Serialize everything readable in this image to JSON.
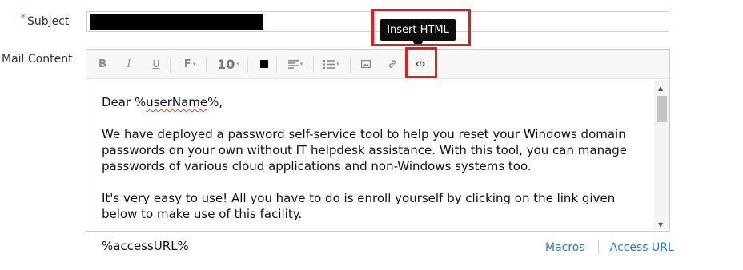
{
  "form": {
    "subject_label": "Subject",
    "required_mark": "*",
    "mail_content_label": "Mail Content"
  },
  "toolbar": {
    "bold": "B",
    "italic": "I",
    "underline": "U",
    "font_family": "F",
    "font_size": "10",
    "icons": [
      "bold-icon",
      "italic-icon",
      "underline-icon",
      "font-family-icon",
      "font-size",
      "text-color-icon",
      "align-icon",
      "list-icon",
      "image-icon",
      "link-icon",
      "insert-html-icon"
    ]
  },
  "tooltip": {
    "text": "Insert HTML"
  },
  "editor": {
    "greeting_prefix": "Dear %",
    "greeting_var": "userName",
    "greeting_suffix": "%,",
    "paragraph1": "We have deployed a password self-service tool to help you reset your Windows domain passwords on your own without IT helpdesk assistance. With this tool, you can manage passwords of various cloud applications and non-Windows systems too.",
    "paragraph2": "It's very easy to use! All you have to do is enroll yourself by clicking on the link given below to make use of this facility.",
    "paragraph3_partial": "%accessURL%"
  },
  "links": {
    "macros": "Macros",
    "access_url": "Access URL"
  },
  "colors": {
    "accent_link": "#2a7ab8",
    "highlight": "#e01e26",
    "required": "#e04a3a"
  }
}
